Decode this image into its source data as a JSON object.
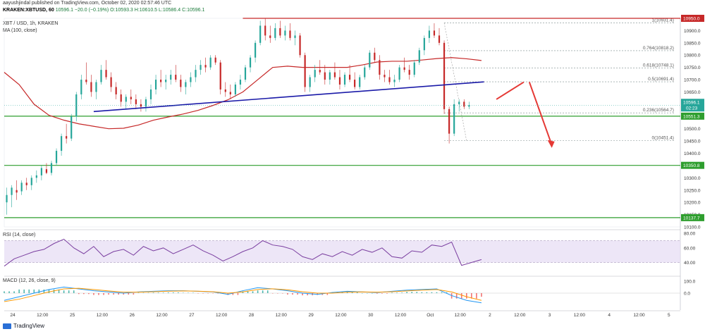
{
  "header": {
    "publisher_line": "aayushjindal published on TradingView.com, October 02, 2020 02:57:46 UTC",
    "symbol_line_prefix": "KRAKEN:XBTUSD, 60",
    "ohlc_values": "10596.1  −20.0 (−0.19%)  O:10593.3  H:10610.5  L:10586.4  C:10596.1",
    "pair_line": "XBT / USD, 1h, KRAKEN",
    "ma_line": "MA (100, close)"
  },
  "footer": {
    "brand": "TradingView"
  },
  "colors": {
    "up": "#26a69a",
    "down": "#c62828",
    "ma": "#c62828",
    "trendline": "#1a1aa8",
    "support": "#2e9e2e",
    "resistance": "#c62828",
    "rsi_line": "#7b3fa0",
    "macd_line": "#2196f3",
    "signal_line": "#ff9800",
    "arrow": "#e53935"
  },
  "chart_data": [
    {
      "type": "candlestick",
      "title": "XBT / USD, 1h, KRAKEN",
      "ylim": [
        10100,
        10950
      ],
      "y_ticks": [
        10100,
        10150,
        10200,
        10250,
        10300,
        10350,
        10400,
        10450,
        10500,
        10550,
        10600,
        10650,
        10700,
        10750,
        10800,
        10850,
        10900
      ],
      "x_ticks": [
        "24",
        "12:00",
        "25",
        "12:00",
        "26",
        "12:00",
        "27",
        "12:00",
        "28",
        "12:00",
        "29",
        "12:00",
        "30",
        "12:00",
        "Oct",
        "12:00",
        "2",
        "12:00",
        "3",
        "12:00",
        "4",
        "12:00",
        "5"
      ],
      "x_tick_hours": [
        0,
        12,
        24,
        36,
        48,
        60,
        72,
        84,
        96,
        108,
        120,
        132,
        144,
        156,
        168,
        180,
        192,
        204,
        216,
        228,
        240,
        252,
        264
      ],
      "last_price": {
        "value": 10596.1,
        "label": "10596.1",
        "countdown": "02:23"
      },
      "price_labels": [
        {
          "value": 10950,
          "label": "10950.0",
          "color": "#c62828"
        },
        {
          "value": 10551.3,
          "label": "10551.3",
          "color": "#2e9e2e"
        },
        {
          "value": 10350.8,
          "label": "10350.8",
          "color": "#2e9e2e"
        },
        {
          "value": 10137.7,
          "label": "10137.7",
          "color": "#2e9e2e"
        }
      ],
      "horizontal_lines": [
        {
          "name": "resistance",
          "value": 10950,
          "from_hour": 96,
          "color": "#c62828"
        },
        {
          "name": "support-1",
          "value": 10551.3,
          "color": "#2e9e2e"
        },
        {
          "name": "support-2",
          "value": 10350.8,
          "color": "#2e9e2e"
        },
        {
          "name": "support-3",
          "value": 10137.7,
          "color": "#2e9e2e"
        }
      ],
      "trendline": {
        "from": [
          36,
          10570
        ],
        "to": [
          193,
          10691
        ]
      },
      "fibonacci": {
        "from_hour": 177,
        "to_hour": 270,
        "levels": [
          {
            "ratio": "1",
            "label": "1(10931.4)",
            "value": 10931.4
          },
          {
            "ratio": "0.764",
            "label": "0.764(10818.2)",
            "value": 10818.2
          },
          {
            "ratio": "0.618",
            "label": "0.618(10748.1)",
            "value": 10748.1
          },
          {
            "ratio": "0.5",
            "label": "0.5(10691.4)",
            "value": 10691.4
          },
          {
            "ratio": "0.236",
            "label": "0.236(10564.7)",
            "value": 10564.7
          },
          {
            "ratio": "0",
            "label": "0(10451.4)",
            "value": 10451.4
          }
        ]
      },
      "ma": {
        "name": "MA (100, close)",
        "x": [
          0,
          6,
          12,
          18,
          24,
          30,
          36,
          42,
          48,
          54,
          60,
          66,
          72,
          78,
          84,
          90,
          96,
          102,
          108,
          114,
          120,
          126,
          132,
          138,
          144,
          150,
          156,
          162,
          168,
          174,
          180,
          186,
          192
        ],
        "y": [
          10730,
          10680,
          10600,
          10555,
          10535,
          10520,
          10510,
          10500,
          10502,
          10515,
          10535,
          10548,
          10560,
          10575,
          10595,
          10618,
          10650,
          10700,
          10750,
          10755,
          10750,
          10750,
          10750,
          10750,
          10760,
          10772,
          10775,
          10775,
          10780,
          10786,
          10790,
          10785,
          10778
        ]
      },
      "candles": [
        [
          10200,
          10260,
          10150,
          10230
        ],
        [
          10230,
          10270,
          10180,
          10260
        ],
        [
          10250,
          10290,
          10210,
          10240
        ],
        [
          10245,
          10290,
          10230,
          10280
        ],
        [
          10280,
          10300,
          10250,
          10270
        ],
        [
          10270,
          10310,
          10250,
          10300
        ],
        [
          10300,
          10330,
          10280,
          10310
        ],
        [
          10310,
          10350,
          10290,
          10340
        ],
        [
          10335,
          10360,
          10315,
          10320
        ],
        [
          10320,
          10370,
          10310,
          10360
        ],
        [
          10360,
          10420,
          10350,
          10410
        ],
        [
          10410,
          10480,
          10390,
          10470
        ],
        [
          10470,
          10520,
          10440,
          10460
        ],
        [
          10460,
          10560,
          10450,
          10550
        ],
        [
          10550,
          10650,
          10530,
          10640
        ],
        [
          10640,
          10720,
          10620,
          10700
        ],
        [
          10700,
          10770,
          10680,
          10690
        ],
        [
          10690,
          10720,
          10630,
          10650
        ],
        [
          10650,
          10700,
          10620,
          10690
        ],
        [
          10690,
          10760,
          10680,
          10740
        ],
        [
          10740,
          10780,
          10700,
          10710
        ],
        [
          10710,
          10730,
          10650,
          10670
        ],
        [
          10670,
          10690,
          10620,
          10640
        ],
        [
          10640,
          10660,
          10590,
          10610
        ],
        [
          10610,
          10640,
          10580,
          10630
        ],
        [
          10630,
          10660,
          10600,
          10620
        ],
        [
          10620,
          10640,
          10580,
          10600
        ],
        [
          10600,
          10620,
          10570,
          10590
        ],
        [
          10590,
          10630,
          10570,
          10620
        ],
        [
          10620,
          10680,
          10600,
          10660
        ],
        [
          10660,
          10720,
          10640,
          10700
        ],
        [
          10700,
          10740,
          10670,
          10690
        ],
        [
          10690,
          10720,
          10660,
          10700
        ],
        [
          10700,
          10740,
          10680,
          10720
        ],
        [
          10720,
          10760,
          10690,
          10700
        ],
        [
          10700,
          10720,
          10650,
          10670
        ],
        [
          10670,
          10700,
          10640,
          10690
        ],
        [
          10690,
          10730,
          10670,
          10710
        ],
        [
          10710,
          10760,
          10690,
          10740
        ],
        [
          10740,
          10780,
          10720,
          10760
        ],
        [
          10760,
          10790,
          10730,
          10750
        ],
        [
          10750,
          10800,
          10740,
          10790
        ],
        [
          10790,
          10800,
          10760,
          10770
        ],
        [
          10770,
          10780,
          10640,
          10660
        ],
        [
          10660,
          10690,
          10630,
          10650
        ],
        [
          10650,
          10680,
          10620,
          10640
        ],
        [
          10640,
          10690,
          10630,
          10680
        ],
        [
          10680,
          10720,
          10660,
          10700
        ],
        [
          10700,
          10760,
          10690,
          10750
        ],
        [
          10750,
          10800,
          10730,
          10790
        ],
        [
          10790,
          10860,
          10770,
          10850
        ],
        [
          10850,
          10940,
          10840,
          10920
        ],
        [
          10920,
          10950,
          10860,
          10880
        ],
        [
          10880,
          10920,
          10850,
          10870
        ],
        [
          10870,
          10930,
          10860,
          10910
        ],
        [
          10910,
          10940,
          10870,
          10880
        ],
        [
          10880,
          10920,
          10860,
          10900
        ],
        [
          10900,
          10930,
          10860,
          10870
        ],
        [
          10870,
          10900,
          10840,
          10880
        ],
        [
          10880,
          10890,
          10790,
          10800
        ],
        [
          10800,
          10810,
          10650,
          10670
        ],
        [
          10670,
          10720,
          10650,
          10710
        ],
        [
          10710,
          10760,
          10690,
          10740
        ],
        [
          10740,
          10780,
          10720,
          10730
        ],
        [
          10730,
          10760,
          10680,
          10700
        ],
        [
          10700,
          10740,
          10680,
          10730
        ],
        [
          10730,
          10770,
          10700,
          10710
        ],
        [
          10710,
          10740,
          10660,
          10680
        ],
        [
          10680,
          10730,
          10670,
          10720
        ],
        [
          10720,
          10760,
          10690,
          10700
        ],
        [
          10700,
          10730,
          10660,
          10670
        ],
        [
          10670,
          10720,
          10660,
          10710
        ],
        [
          10710,
          10760,
          10700,
          10750
        ],
        [
          10750,
          10820,
          10740,
          10810
        ],
        [
          10810,
          10830,
          10770,
          10780
        ],
        [
          10780,
          10800,
          10700,
          10720
        ],
        [
          10720,
          10740,
          10690,
          10710
        ],
        [
          10710,
          10740,
          10680,
          10690
        ],
        [
          10690,
          10720,
          10670,
          10700
        ],
        [
          10700,
          10760,
          10690,
          10750
        ],
        [
          10750,
          10790,
          10730,
          10740
        ],
        [
          10740,
          10760,
          10700,
          10720
        ],
        [
          10720,
          10780,
          10710,
          10770
        ],
        [
          10770,
          10830,
          10760,
          10820
        ],
        [
          10820,
          10880,
          10800,
          10870
        ],
        [
          10870,
          10920,
          10850,
          10900
        ],
        [
          10900,
          10930,
          10870,
          10880
        ],
        [
          10880,
          10910,
          10840,
          10850
        ],
        [
          10850,
          10860,
          10560,
          10580
        ],
        [
          10580,
          10590,
          10440,
          10480
        ],
        [
          10480,
          10620,
          10470,
          10600
        ],
        [
          10600,
          10620,
          10570,
          10610
        ],
        [
          10610,
          10620,
          10580,
          10590
        ],
        [
          10590,
          10610,
          10580,
          10596
        ]
      ]
    },
    {
      "type": "line",
      "title": "RSI (14, close)",
      "ylim": [
        25,
        85
      ],
      "y_ticks": [
        40,
        60,
        80
      ],
      "y_tick_labels": [
        "40.00",
        "60.00",
        "80.00"
      ],
      "band": [
        40,
        70
      ],
      "series": [
        {
          "name": "RSI (14, close)",
          "x": [
            0,
            4,
            8,
            12,
            16,
            20,
            24,
            28,
            32,
            36,
            40,
            44,
            48,
            52,
            56,
            60,
            64,
            68,
            72,
            76,
            80,
            84,
            88,
            92,
            96,
            100,
            104,
            108,
            112,
            116,
            120,
            124,
            128,
            132,
            136,
            140,
            144,
            148,
            152,
            156,
            160,
            164,
            168,
            172,
            176,
            180,
            184,
            188,
            192
          ],
          "y": [
            35,
            45,
            50,
            55,
            58,
            66,
            72,
            60,
            52,
            62,
            48,
            55,
            58,
            50,
            62,
            56,
            60,
            52,
            58,
            64,
            56,
            50,
            42,
            48,
            55,
            60,
            70,
            64,
            62,
            58,
            48,
            44,
            52,
            48,
            55,
            50,
            58,
            54,
            60,
            48,
            46,
            56,
            54,
            64,
            62,
            68,
            36,
            40,
            44
          ]
        }
      ]
    },
    {
      "type": "line",
      "title": "MACD (12, 26, close, 9)",
      "ylim": [
        -140,
        140
      ],
      "y_ticks": [
        0,
        100
      ],
      "y_tick_labels": [
        "0.0",
        "100.0"
      ],
      "series": [
        {
          "name": "MACD",
          "x": [
            0,
            6,
            12,
            18,
            24,
            30,
            36,
            42,
            48,
            54,
            60,
            66,
            72,
            78,
            84,
            90,
            96,
            102,
            108,
            114,
            120,
            126,
            132,
            138,
            144,
            150,
            156,
            162,
            168,
            174,
            180,
            186,
            192
          ],
          "y": [
            -60,
            -30,
            0,
            30,
            50,
            35,
            20,
            10,
            0,
            10,
            15,
            20,
            20,
            15,
            10,
            -10,
            20,
            45,
            35,
            20,
            0,
            -10,
            5,
            15,
            10,
            5,
            15,
            25,
            30,
            35,
            -20,
            -60,
            -80
          ]
        },
        {
          "name": "Signal",
          "x": [
            0,
            6,
            12,
            18,
            24,
            30,
            36,
            42,
            48,
            54,
            60,
            66,
            72,
            78,
            84,
            90,
            96,
            102,
            108,
            114,
            120,
            126,
            132,
            138,
            144,
            150,
            156,
            162,
            168,
            174,
            180,
            186,
            192
          ],
          "y": [
            -70,
            -50,
            -20,
            10,
            35,
            40,
            30,
            18,
            8,
            8,
            12,
            16,
            18,
            16,
            12,
            0,
            10,
            30,
            36,
            28,
            12,
            0,
            0,
            8,
            10,
            8,
            12,
            18,
            25,
            30,
            10,
            -30,
            -60
          ]
        }
      ]
    }
  ]
}
